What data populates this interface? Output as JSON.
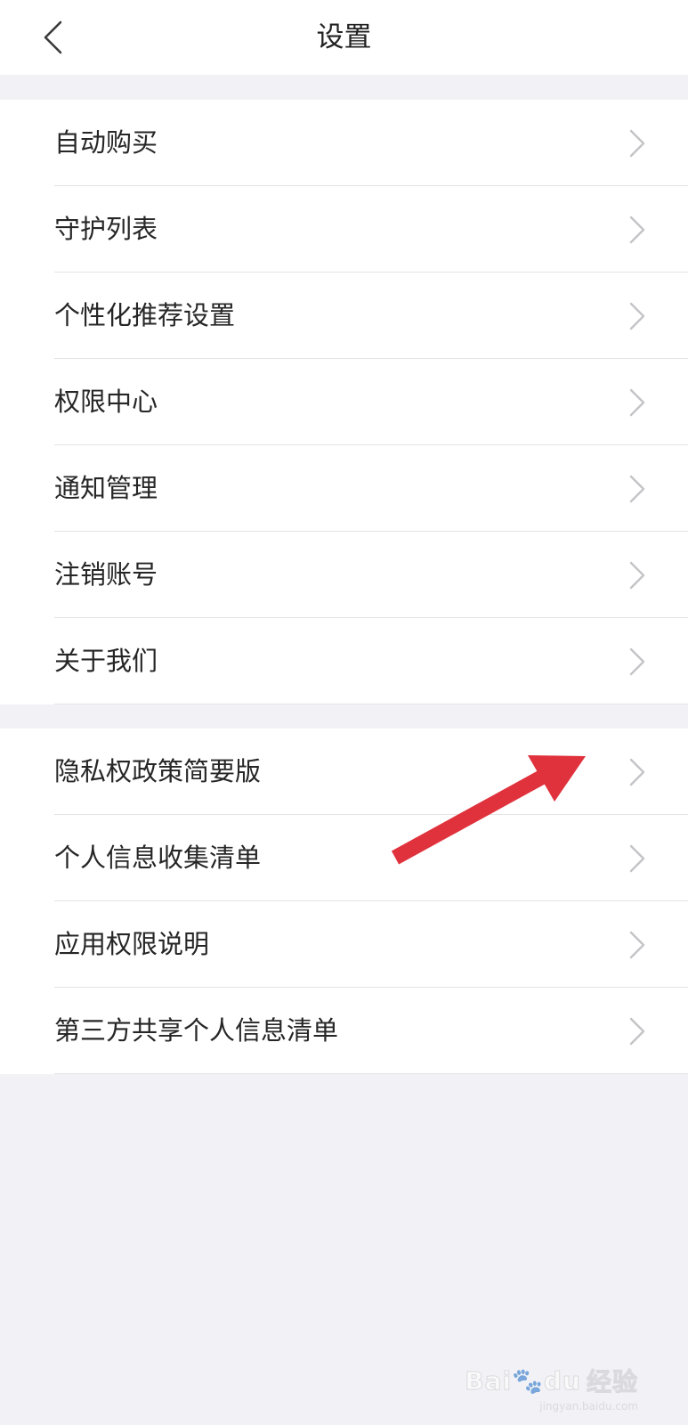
{
  "header": {
    "title": "设置",
    "back_icon": "chevron-left-icon"
  },
  "groups": [
    {
      "items": [
        {
          "label": "自动购买"
        },
        {
          "label": "守护列表"
        },
        {
          "label": "个性化推荐设置"
        },
        {
          "label": "权限中心"
        },
        {
          "label": "通知管理"
        },
        {
          "label": "注销账号"
        },
        {
          "label": "关于我们"
        }
      ]
    },
    {
      "items": [
        {
          "label": "隐私权政策简要版"
        },
        {
          "label": "个人信息收集清单"
        },
        {
          "label": "应用权限说明"
        },
        {
          "label": "第三方共享个人信息清单"
        }
      ]
    }
  ],
  "row_icon": "chevron-right-icon",
  "annotation": {
    "arrow_color": "#e0323c",
    "points_to": "隐私权政策简要版"
  },
  "watermark": {
    "logo": "Bai",
    "logo_suffix": "du",
    "text": "经验",
    "sub": "jingyan.baidu.com"
  }
}
